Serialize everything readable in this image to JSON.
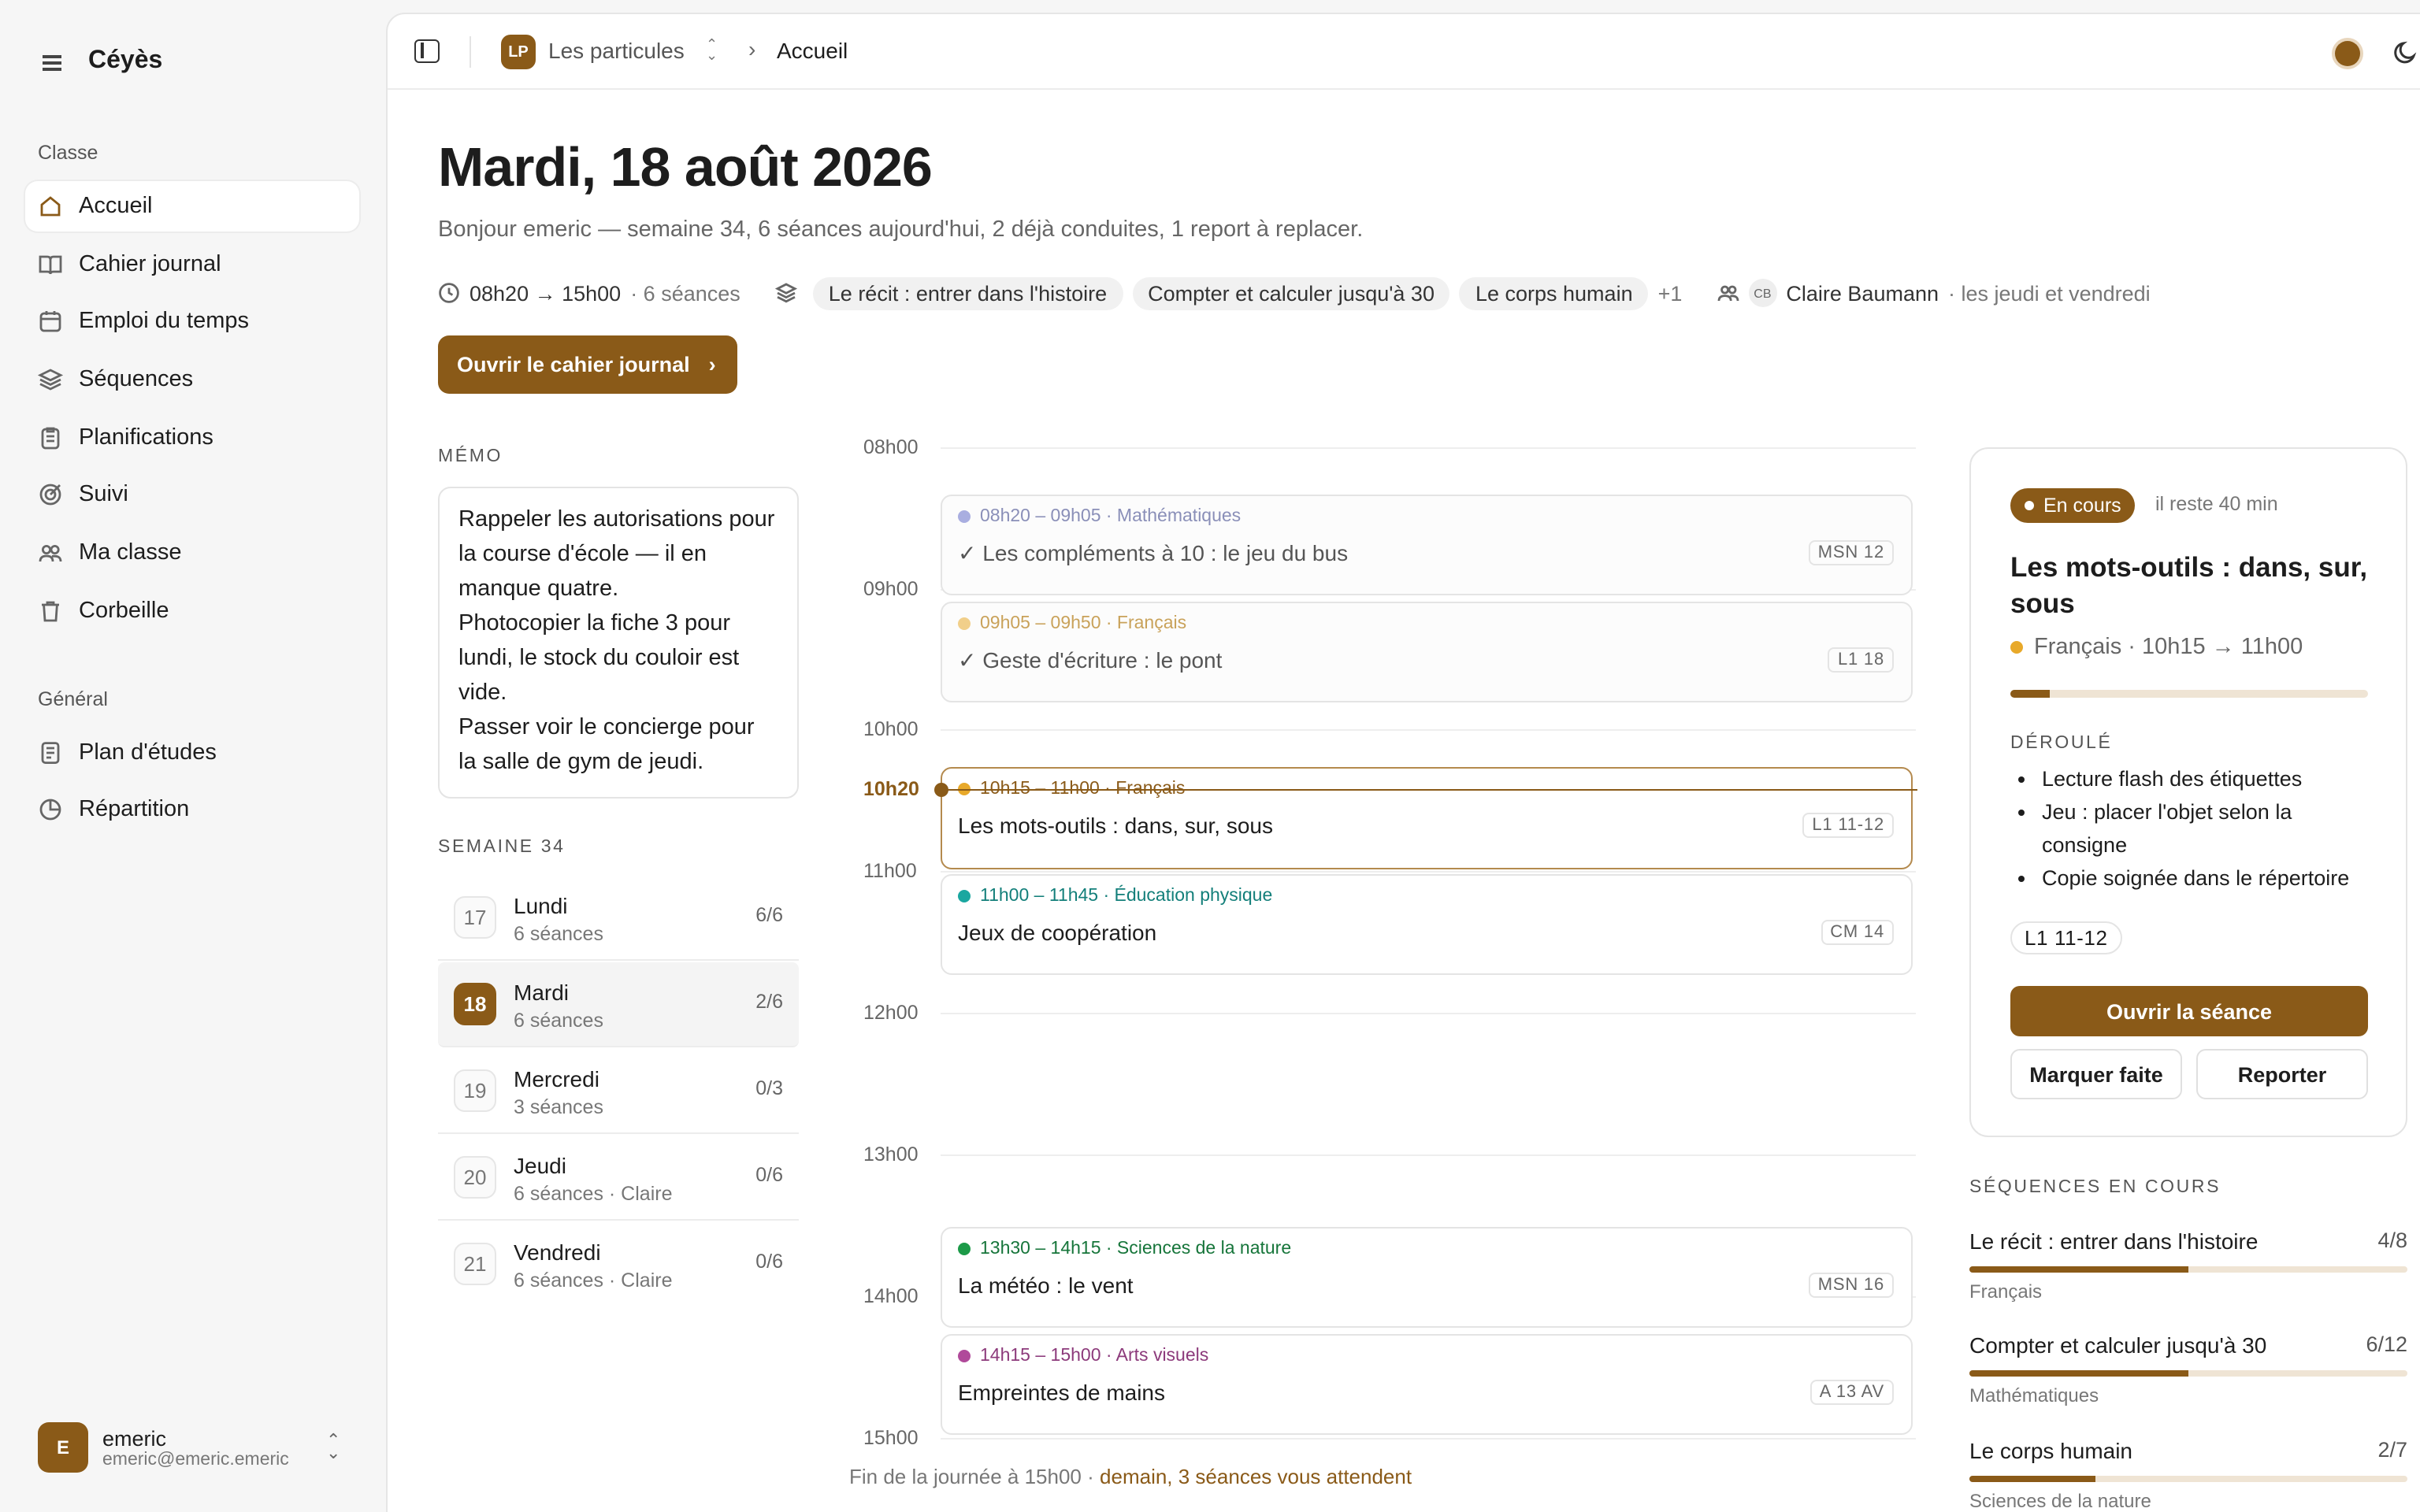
{
  "app": {
    "name": "Céyès"
  },
  "sidebar": {
    "section_classe": "Classe",
    "section_general": "Général",
    "items": [
      {
        "label": "Accueil"
      },
      {
        "label": "Cahier journal"
      },
      {
        "label": "Emploi du temps"
      },
      {
        "label": "Séquences"
      },
      {
        "label": "Planifications"
      },
      {
        "label": "Suivi"
      },
      {
        "label": "Ma classe"
      },
      {
        "label": "Corbeille"
      },
      {
        "label": "Plan d'études"
      },
      {
        "label": "Répartition"
      }
    ],
    "user": {
      "initial": "E",
      "name": "emeric",
      "email": "emeric@emeric.emeric"
    }
  },
  "topbar": {
    "class_initials": "LP",
    "class_name": "Les particules",
    "page": "Accueil"
  },
  "header": {
    "title": "Mardi, 18 août 2026",
    "subtitle": "Bonjour emeric — semaine 34, 6 séances aujourd'hui, 2 déjà conduites, 1 report à replacer.",
    "hours": "08h20 → 15h00",
    "sessions": "· 6 séances",
    "chips": [
      "Le récit : entrer dans l'histoire",
      "Compter et calculer jusqu'à 30",
      "Le corps humain"
    ],
    "more": "+1",
    "colleague_initials": "CB",
    "colleague": "Claire Baumann",
    "colleague_when": "· les jeudi et vendredi",
    "open_button": "Ouvrir le cahier journal"
  },
  "memo": {
    "label": "MÉMO",
    "lines": [
      "Rappeler les autorisations pour la course d'école — il en manque quatre.",
      "Photocopier la fiche 3 pour lundi, le stock du couloir est vide.",
      "Passer voir le concierge pour la salle de gym de jeudi."
    ]
  },
  "week": {
    "label": "SEMAINE 34",
    "days": [
      {
        "num": "17",
        "name": "Lundi",
        "sub": "6 séances",
        "count": "6/6"
      },
      {
        "num": "18",
        "name": "Mardi",
        "sub": "6 séances",
        "count": "2/6"
      },
      {
        "num": "19",
        "name": "Mercredi",
        "sub": "3 séances",
        "count": "0/3"
      },
      {
        "num": "20",
        "name": "Jeudi",
        "sub": "6 séances · Claire",
        "count": "0/6"
      },
      {
        "num": "21",
        "name": "Vendredi",
        "sub": "6 séances · Claire",
        "count": "0/6"
      }
    ]
  },
  "timeline": {
    "hours": [
      "08h00",
      "09h00",
      "10h00",
      "11h00",
      "12h00",
      "13h00",
      "14h00",
      "15h00"
    ],
    "now": "10h20",
    "events": [
      {
        "time": "08h20 – 09h05 · Mathématiques",
        "title": "✓  Les compléments à 10 : le jeu du bus",
        "code": "MSN 12",
        "color": "#a9aee0",
        "text_color": "#8a8fb8"
      },
      {
        "time": "09h05 – 09h50 · Français",
        "title": "✓  Geste d'écriture : le pont",
        "code": "L1 18",
        "color": "#f1cf8a",
        "text_color": "#c9a25a"
      },
      {
        "time": "10h15 – 11h00 · Français",
        "title": "Les mots-outils : dans, sur, sous",
        "code": "L1 11-12",
        "color": "#e8a92a",
        "text_color": "#8a5a18"
      },
      {
        "time": "11h00 – 11h45 · Éducation physique",
        "title": "Jeux de coopération",
        "code": "CM 14",
        "color": "#1aa7a0",
        "text_color": "#137f7a"
      },
      {
        "time": "13h30 – 14h15 · Sciences de la nature",
        "title": "La météo : le vent",
        "code": "MSN 16",
        "color": "#1c9a48",
        "text_color": "#16753a"
      },
      {
        "time": "14h15 – 15h00 · Arts visuels",
        "title": "Empreintes de mains",
        "code": "A 13 AV",
        "color": "#b04a9a",
        "text_color": "#8c3a7b"
      }
    ],
    "footer": "Fin de la journée à 15h00 ·",
    "footer_link": "demain, 3 séances vous attendent"
  },
  "current": {
    "badge": "En cours",
    "remaining": "il reste 40 min",
    "title": "Les mots-outils : dans, sur, sous",
    "subject": "Français · 10h15 → 11h00",
    "progress": 0.11,
    "deroule_label": "DÉROULÉ",
    "steps": [
      "Lecture flash des étiquettes",
      "Jeu : placer l'objet selon la consigne",
      "Copie soignée dans le répertoire"
    ],
    "code": "L1 11-12",
    "open": "Ouvrir la séance",
    "done": "Marquer faite",
    "postpone": "Reporter"
  },
  "sequences": {
    "label": "SÉQUENCES EN COURS",
    "items": [
      {
        "name": "Le récit : entrer dans l'histoire",
        "count": "4/8",
        "subject": "Français",
        "progress": 0.5
      },
      {
        "name": "Compter et calculer jusqu'à 30",
        "count": "6/12",
        "subject": "Mathématiques",
        "progress": 0.5
      },
      {
        "name": "Le corps humain",
        "count": "2/7",
        "subject": "Sciences de la nature",
        "progress": 0.286
      }
    ]
  },
  "colors": {
    "accent": "#8a5a18"
  }
}
